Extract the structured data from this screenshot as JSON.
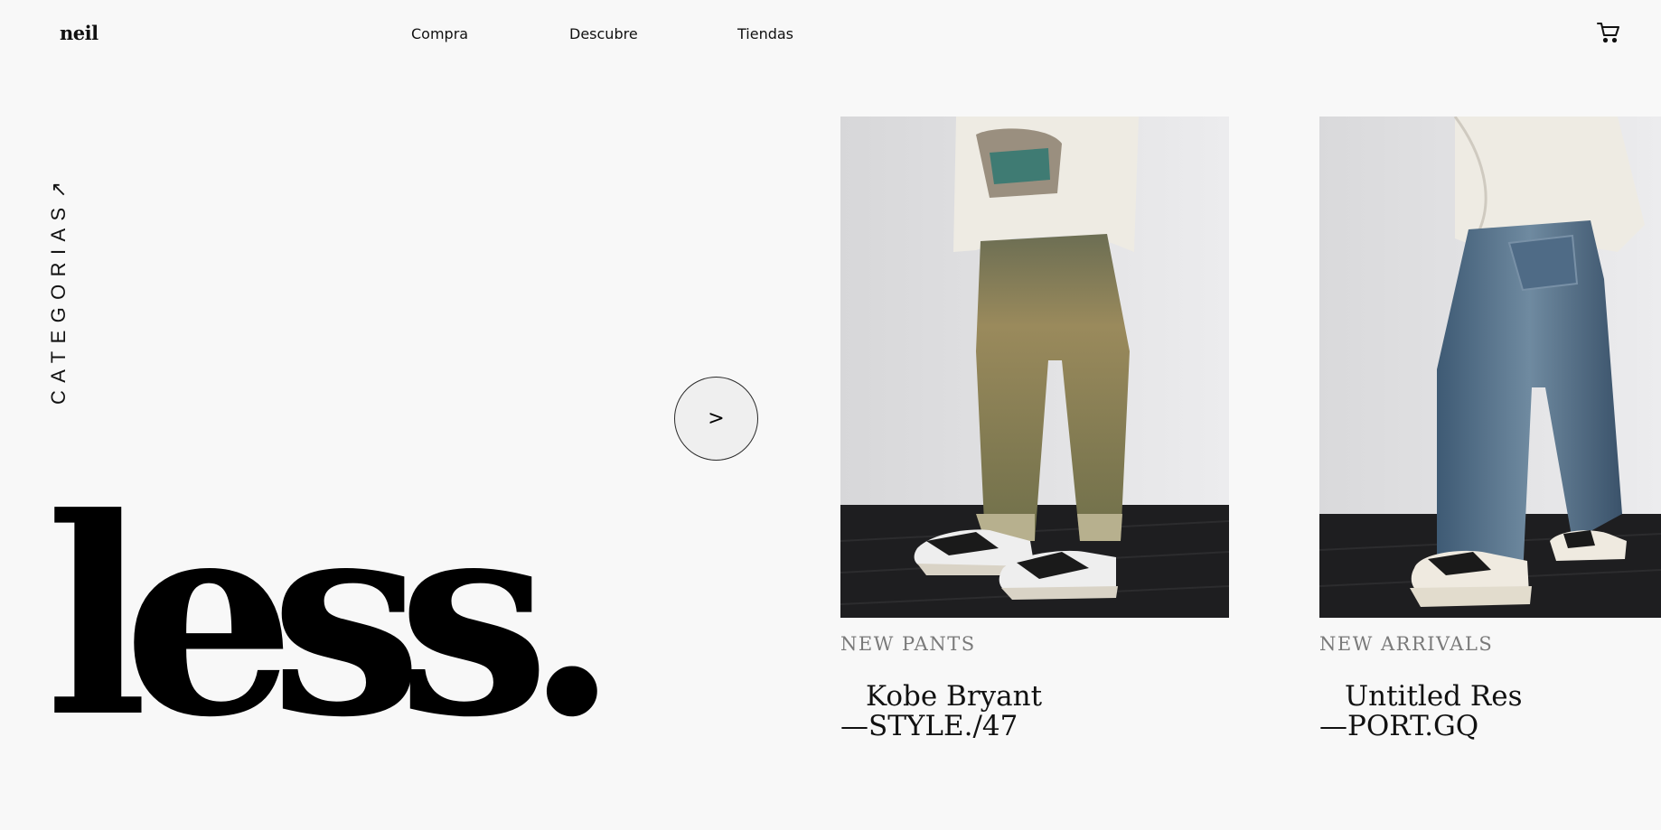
{
  "header": {
    "brand": "neil",
    "nav": [
      {
        "label": "Compra"
      },
      {
        "label": "Descubre"
      },
      {
        "label": "Tiendas"
      }
    ],
    "cart_icon": "cart-icon"
  },
  "sidebar": {
    "categories_label": "CATEGORIAS",
    "categories_arrow": "↗"
  },
  "hero": {
    "word": "less."
  },
  "carousel": {
    "next_label": ">"
  },
  "products": [
    {
      "tag": "NEW PANTS",
      "title_line1": "Kobe Bryant",
      "title_line2": "—STYLE./47",
      "jeans_color": "#7d7a4e"
    },
    {
      "tag": "NEW ARRIVALS",
      "title_line1": "Untitled Res",
      "title_line2": "—PORT.GQ",
      "jeans_color": "#4d6a84"
    }
  ]
}
